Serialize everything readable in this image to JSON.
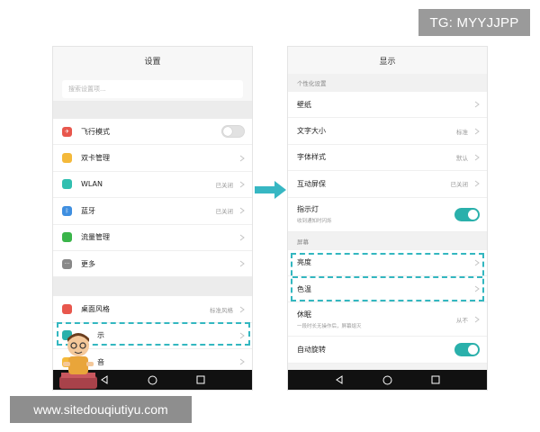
{
  "watermark": {
    "tg": "TG: MYYJJPP",
    "website": "www.sitedouqiutiyu.com"
  },
  "left_screen": {
    "title": "设置",
    "search_placeholder": "搜索设置项...",
    "items": [
      {
        "label": "飞行模式",
        "icon": "airplane-icon",
        "icon_color": "#e8574d",
        "control": "toggle-off"
      },
      {
        "label": "双卡管理",
        "icon": "sim-card-icon",
        "icon_color": "#f4b93a",
        "control": "chevron"
      },
      {
        "label": "WLAN",
        "icon": "wifi-icon",
        "icon_color": "#31bfb0",
        "value": "已关闭",
        "control": "chevron"
      },
      {
        "label": "蓝牙",
        "icon": "bluetooth-icon",
        "icon_color": "#3f8fe0",
        "value": "已关闭",
        "control": "chevron"
      },
      {
        "label": "流量管理",
        "icon": "data-usage-icon",
        "icon_color": "#3ab54a",
        "control": "chevron"
      },
      {
        "label": "更多",
        "icon": "more-icon",
        "icon_color": "#888888",
        "control": "chevron"
      }
    ],
    "items2": [
      {
        "label": "桌面风格",
        "icon": "home-icon",
        "icon_color": "#e8574d",
        "value": "标准风格",
        "control": "chevron"
      },
      {
        "label": "显示",
        "visible_text": "示",
        "icon": "display-icon",
        "icon_color": "#2ab0ab",
        "control": "chevron"
      },
      {
        "label": "",
        "visible_text": "音",
        "icon": "sound-icon",
        "icon_color": "#f4b93a",
        "control": "chevron"
      }
    ]
  },
  "right_screen": {
    "title": "显示",
    "section_personal": "个性化设置",
    "items": [
      {
        "label": "壁纸",
        "control": "chevron"
      },
      {
        "label": "文字大小",
        "value": "标准",
        "control": "chevron"
      },
      {
        "label": "字体样式",
        "value": "默认",
        "control": "chevron"
      },
      {
        "label": "互动屏保",
        "value": "已关闭",
        "control": "chevron"
      },
      {
        "label": "指示灯",
        "sub": "收到通知时闪烁",
        "control": "toggle-on"
      }
    ],
    "section_screen": "屏幕",
    "items2": [
      {
        "label": "亮度",
        "control": "chevron"
      },
      {
        "label": "色温",
        "control": "chevron"
      },
      {
        "label": "休眠",
        "sub": "一段时长无操作后，屏幕熄灭",
        "value": "从不",
        "control": "chevron"
      },
      {
        "label": "自动旋转",
        "control": "toggle-on"
      }
    ]
  },
  "colors": {
    "accent": "#2ab0ab",
    "highlight_dash": "#33b7c0",
    "nav_bar": "#111111"
  }
}
